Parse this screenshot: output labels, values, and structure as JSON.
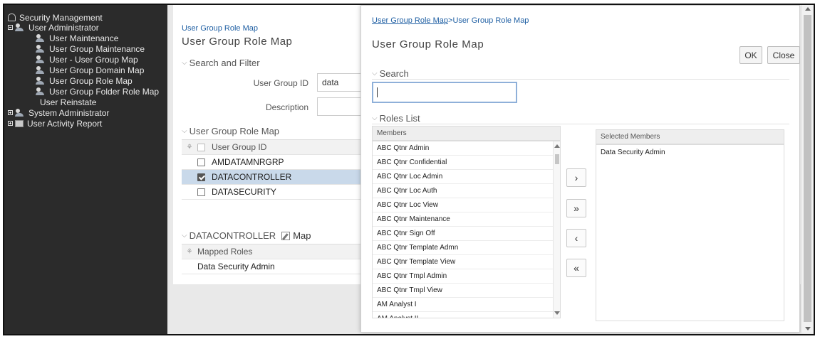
{
  "tree": {
    "root": "Security Management",
    "user_admin": "User Administrator",
    "children": [
      "User Maintenance",
      "User Group Maintenance",
      "User - User Group Map",
      "User Group Domain Map",
      "User Group Role Map",
      "User Group Folder Role Map"
    ],
    "reinstate": "User Reinstate",
    "sysadmin": "System Administrator",
    "activity": "User Activity Report"
  },
  "main": {
    "title_link": "User Group Role Map",
    "page_title": "User Group Role Map",
    "search_section": "Search and Filter",
    "group_id_label": "User Group ID",
    "group_id_value": "data",
    "desc_label": "Description",
    "desc_value": "",
    "grid_section": "User Group Role Map",
    "grid_header": "User Group ID",
    "rows": [
      "AMDATAMNRGRP",
      "DATACONTROLLER",
      "DATASECURITY"
    ],
    "mapped_section": "DATACONTROLLER",
    "map_label": "Map",
    "mapped_header": "Mapped Roles",
    "mapped_rows": [
      "Data Security Admin"
    ]
  },
  "modal": {
    "crumb_link": "User Group Role Map",
    "crumb_sep": ">",
    "crumb_current": "User Group Role Map",
    "title": "User Group Role Map",
    "ok": "OK",
    "close": "Close",
    "search_section": "Search",
    "search_value": "",
    "roles_section": "Roles List",
    "members_header": "Members",
    "selected_header": "Selected Members",
    "members": [
      "ABC Qtnr Admin",
      "ABC Qtnr Confidential",
      "ABC Qtnr Loc Admin",
      "ABC Qtnr Loc Auth",
      "ABC Qtnr Loc View",
      "ABC Qtnr Maintenance",
      "ABC Qtnr Sign Off",
      "ABC Qtnr Template Admn",
      "ABC Qtnr Template View",
      "ABC Qtnr Tmpl Admin",
      "ABC Qtnr Tmpl View",
      "AM Analyst I",
      "AM Analyst II"
    ],
    "selected": [
      "Data Security Admin"
    ],
    "move_one": "›",
    "move_all": "»",
    "remove_one": "‹",
    "remove_all": "«"
  }
}
